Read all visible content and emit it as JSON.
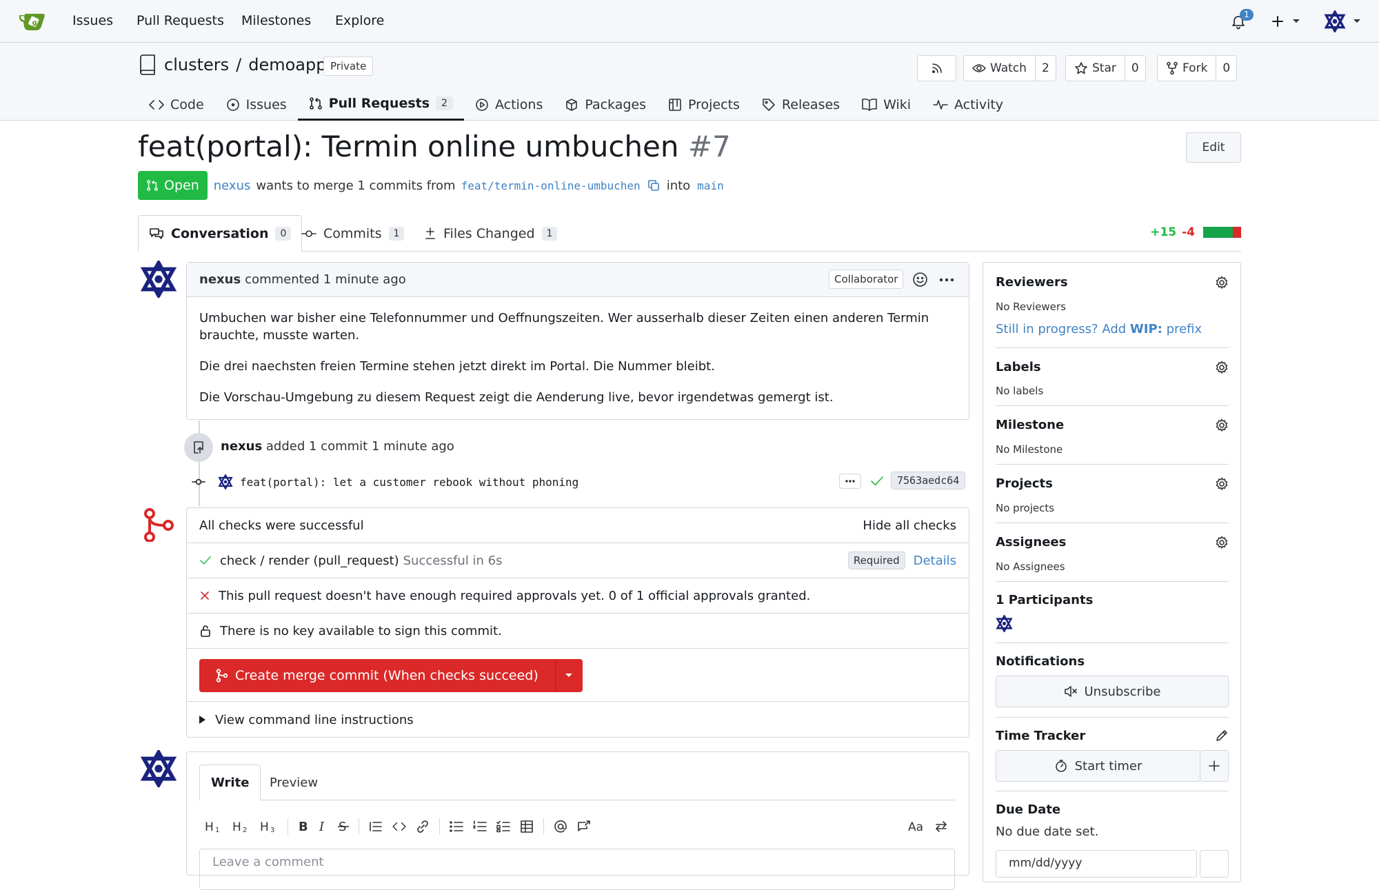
{
  "topnav": {
    "links": [
      "Issues",
      "Pull Requests",
      "Milestones",
      "Explore"
    ],
    "notification_count": "1"
  },
  "repo": {
    "owner": "clusters",
    "separator": "/",
    "name": "demoapp",
    "visibility": "Private",
    "watch_label": "Watch",
    "watch_count": "2",
    "star_label": "Star",
    "star_count": "0",
    "fork_label": "Fork",
    "fork_count": "0",
    "tabs": [
      {
        "label": "Code"
      },
      {
        "label": "Issues"
      },
      {
        "label": "Pull Requests",
        "count": "2"
      },
      {
        "label": "Actions"
      },
      {
        "label": "Packages"
      },
      {
        "label": "Projects"
      },
      {
        "label": "Releases"
      },
      {
        "label": "Wiki"
      },
      {
        "label": "Activity"
      }
    ]
  },
  "pr": {
    "title": "feat(portal): Termin online umbuchen",
    "number": "#7",
    "edit_label": "Edit",
    "state": "Open",
    "author": "nexus",
    "merge_text": "wants to merge 1 commits from",
    "head_branch": "feat/termin-online-umbuchen",
    "into_text": "into",
    "base_branch": "main",
    "tabs": [
      {
        "label": "Conversation",
        "count": "0"
      },
      {
        "label": "Commits",
        "count": "1"
      },
      {
        "label": "Files Changed",
        "count": "1"
      }
    ],
    "additions": "+15",
    "deletions": "-4"
  },
  "comment": {
    "author": "nexus",
    "action": "commented 1 minute ago",
    "role": "Collaborator",
    "paragraphs": [
      "Umbuchen war bisher eine Telefonnummer und Oeffnungszeiten. Wer ausserhalb dieser Zeiten einen anderen Termin brauchte, musste warten.",
      "Die drei naechsten freien Termine stehen jetzt direkt im Portal. Die Nummer bleibt.",
      "Die Vorschau-Umgebung zu diesem Request zeigt die Aenderung live, bevor irgendetwas gemergt ist."
    ]
  },
  "commit_event": {
    "author": "nexus",
    "action": "added 1 commit 1 minute ago",
    "message": "feat(portal): let a customer rebook without phoning",
    "sha": "7563aedc64"
  },
  "merge": {
    "checks_summary": "All checks were successful",
    "hide_checks": "Hide all checks",
    "check_name": "check / render (pull_request)",
    "check_status": "Successful in 6s",
    "required_label": "Required",
    "details_label": "Details",
    "approval_msg": "This pull request doesn't have enough required approvals yet. 0 of 1 official approvals granted.",
    "sign_msg": "There is no key available to sign this commit.",
    "merge_button": "Create merge commit (When checks succeed)",
    "cli_instructions": "View command line instructions"
  },
  "editor": {
    "write_tab": "Write",
    "preview_tab": "Preview",
    "placeholder": "Leave a comment"
  },
  "sidebar": {
    "reviewers_title": "Reviewers",
    "reviewers_value": "No Reviewers",
    "wip_prefix": "Still in progress? Add",
    "wip_bold": "WIP:",
    "wip_suffix": "prefix",
    "labels_title": "Labels",
    "labels_value": "No labels",
    "milestone_title": "Milestone",
    "milestone_value": "No Milestone",
    "projects_title": "Projects",
    "projects_value": "No projects",
    "assignees_title": "Assignees",
    "assignees_value": "No Assignees",
    "participants_title": "1 Participants",
    "notifications_title": "Notifications",
    "unsubscribe_label": "Unsubscribe",
    "time_tracker_title": "Time Tracker",
    "start_timer_label": "Start timer",
    "due_date_title": "Due Date",
    "due_date_value": "No due date set.",
    "due_date_placeholder": "mm/dd/yyyy"
  },
  "colors": {
    "accent": "#4183c4",
    "open_green": "#21ba45",
    "merge_red": "#db2828",
    "check_green": "#21ba45",
    "fail_red": "#db2828",
    "avatar_navy": "#1a237e"
  }
}
